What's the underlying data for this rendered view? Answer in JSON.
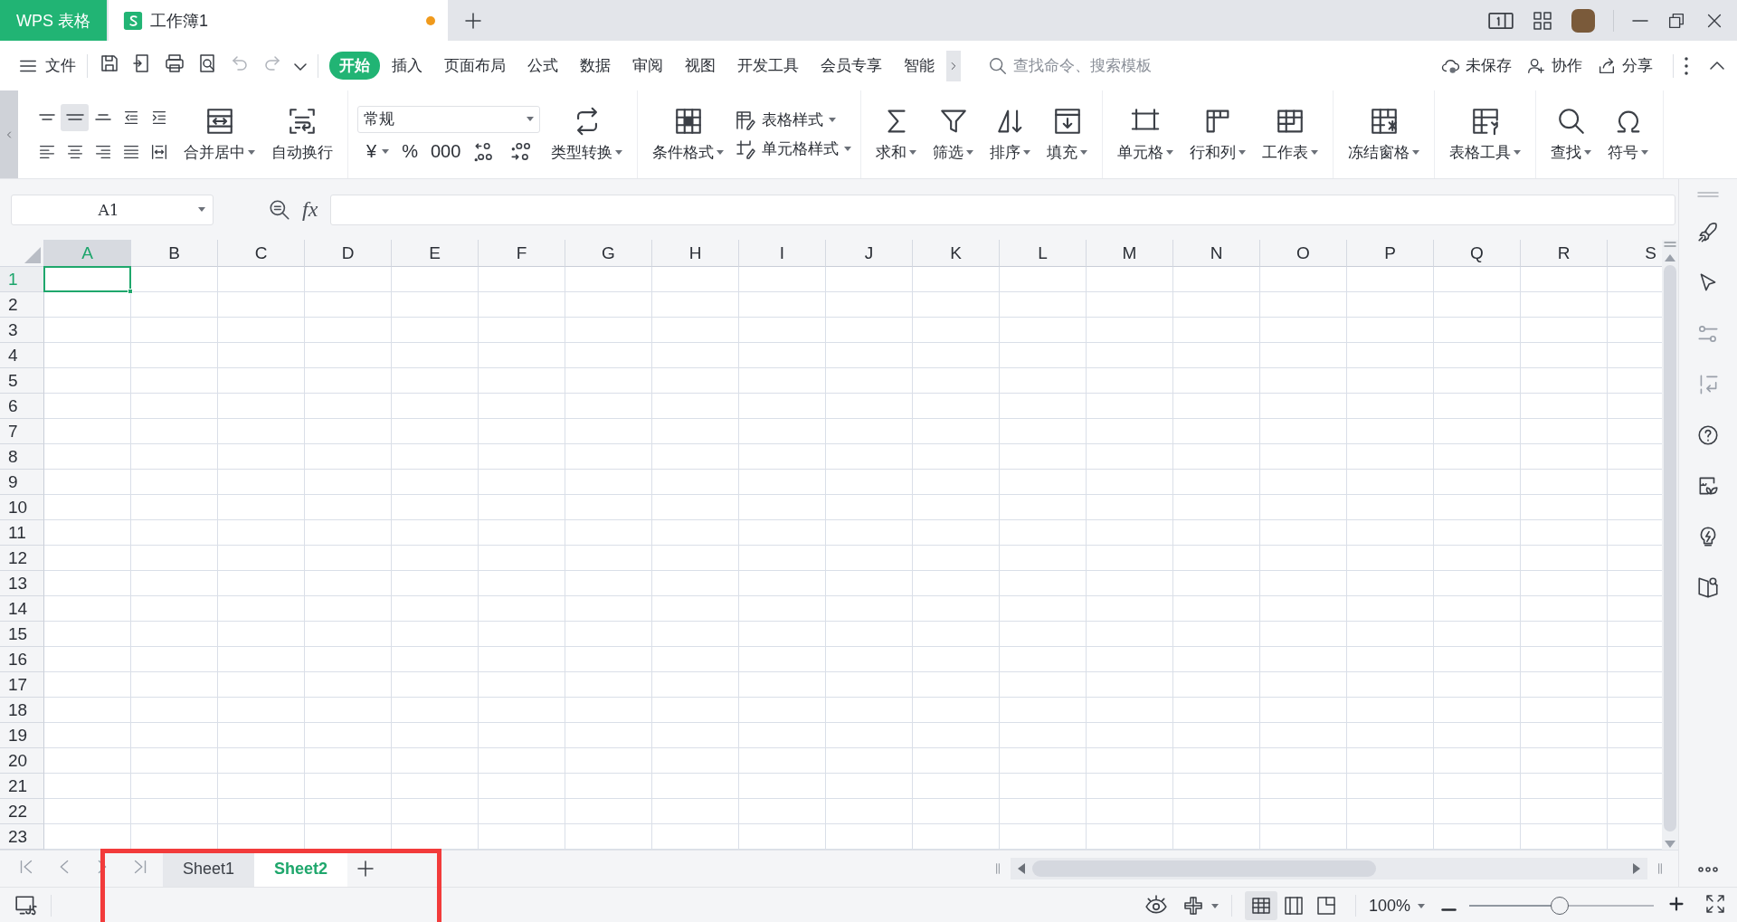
{
  "title_bar": {
    "app_tab": "WPS 表格",
    "document_tab": {
      "title": "工作簿1",
      "unsaved": true
    }
  },
  "menu_bar": {
    "file": "文件",
    "tabs": [
      {
        "label": "开始",
        "selected": true
      },
      {
        "label": "插入",
        "selected": false
      },
      {
        "label": "页面布局",
        "selected": false
      },
      {
        "label": "公式",
        "selected": false
      },
      {
        "label": "数据",
        "selected": false
      },
      {
        "label": "审阅",
        "selected": false
      },
      {
        "label": "视图",
        "selected": false
      },
      {
        "label": "开发工具",
        "selected": false
      },
      {
        "label": "会员专享",
        "selected": false
      },
      {
        "label": "智能",
        "selected": false
      }
    ],
    "search": {
      "placeholder": "查找命令、搜索模板"
    },
    "actions": [
      "未保存",
      "协作",
      "分享"
    ]
  },
  "ribbon": {
    "alignment_buttons": [
      {
        "selected": false
      },
      {
        "selected": true
      },
      {
        "selected": false
      },
      {
        "selected": false
      },
      {
        "selected": false
      },
      {
        "selected": false
      },
      {
        "selected": false
      },
      {
        "selected": false
      },
      {
        "selected": false
      },
      {
        "selected": false
      }
    ],
    "text_buttons": [
      {
        "label": "合并居中",
        "dropdown": true
      },
      {
        "label": "自动换行",
        "dropdown": false
      }
    ],
    "number_format": {
      "value": "常规",
      "symbols": [
        {
          "label": "¥",
          "dropdown": true
        },
        {
          "label": "%",
          "dropdown": false
        },
        {
          "label": "000",
          "dropdown": false
        }
      ]
    },
    "type_convert": {
      "label": "类型转换",
      "dropdown": true
    },
    "conditional_format": {
      "label": "条件格式",
      "dropdown": true
    },
    "style_buttons": [
      {
        "label": "表格样式",
        "dropdown": true
      },
      {
        "label": "单元格样式",
        "dropdown": true
      }
    ],
    "groups": [
      [
        {
          "label": "求和",
          "dropdown": true
        },
        {
          "label": "筛选",
          "dropdown": true
        },
        {
          "label": "排序",
          "dropdown": true
        },
        {
          "label": "填充",
          "dropdown": true
        }
      ],
      [
        {
          "label": "单元格",
          "dropdown": true
        },
        {
          "label": "行和列",
          "dropdown": true
        },
        {
          "label": "工作表",
          "dropdown": true
        }
      ],
      [
        {
          "label": "冻结窗格",
          "dropdown": true
        }
      ],
      [
        {
          "label": "表格工具",
          "dropdown": true
        }
      ],
      [
        {
          "label": "查找",
          "dropdown": true
        },
        {
          "label": "符号",
          "dropdown": true
        }
      ]
    ]
  },
  "formula_bar": {
    "name_box": "A1",
    "function_label": "fx"
  },
  "sheet": {
    "columns": [
      {
        "label": "A",
        "selected": true
      },
      {
        "label": "B",
        "selected": false
      },
      {
        "label": "C",
        "selected": false
      },
      {
        "label": "D",
        "selected": false
      },
      {
        "label": "E",
        "selected": false
      },
      {
        "label": "F",
        "selected": false
      },
      {
        "label": "G",
        "selected": false
      },
      {
        "label": "H",
        "selected": false
      },
      {
        "label": "I",
        "selected": false
      },
      {
        "label": "J",
        "selected": false
      },
      {
        "label": "K",
        "selected": false
      },
      {
        "label": "L",
        "selected": false
      },
      {
        "label": "M",
        "selected": false
      },
      {
        "label": "N",
        "selected": false
      },
      {
        "label": "O",
        "selected": false
      },
      {
        "label": "P",
        "selected": false
      },
      {
        "label": "Q",
        "selected": false
      },
      {
        "label": "R",
        "selected": false
      },
      {
        "label": "S",
        "selected": false
      }
    ],
    "rows": [
      {
        "label": "1",
        "selected": true
      },
      {
        "label": "2",
        "selected": false
      },
      {
        "label": "3",
        "selected": false
      },
      {
        "label": "4",
        "selected": false
      },
      {
        "label": "5",
        "selected": false
      },
      {
        "label": "6",
        "selected": false
      },
      {
        "label": "7",
        "selected": false
      },
      {
        "label": "8",
        "selected": false
      },
      {
        "label": "9",
        "selected": false
      },
      {
        "label": "10",
        "selected": false
      },
      {
        "label": "11",
        "selected": false
      },
      {
        "label": "12",
        "selected": false
      },
      {
        "label": "13",
        "selected": false
      },
      {
        "label": "14",
        "selected": false
      },
      {
        "label": "15",
        "selected": false
      },
      {
        "label": "16",
        "selected": false
      },
      {
        "label": "17",
        "selected": false
      },
      {
        "label": "18",
        "selected": false
      },
      {
        "label": "19",
        "selected": false
      },
      {
        "label": "20",
        "selected": false
      },
      {
        "label": "21",
        "selected": false
      },
      {
        "label": "22",
        "selected": false
      },
      {
        "label": "23",
        "selected": false
      }
    ]
  },
  "sheet_tabs": [
    {
      "label": "Sheet1",
      "selected": false
    },
    {
      "label": "Sheet2",
      "selected": true
    }
  ],
  "status_bar": {
    "views": [
      {
        "selected": true
      },
      {
        "selected": false
      },
      {
        "selected": false
      }
    ],
    "zoom": "100%",
    "zoom_slider": {
      "level": 0.49
    }
  }
}
